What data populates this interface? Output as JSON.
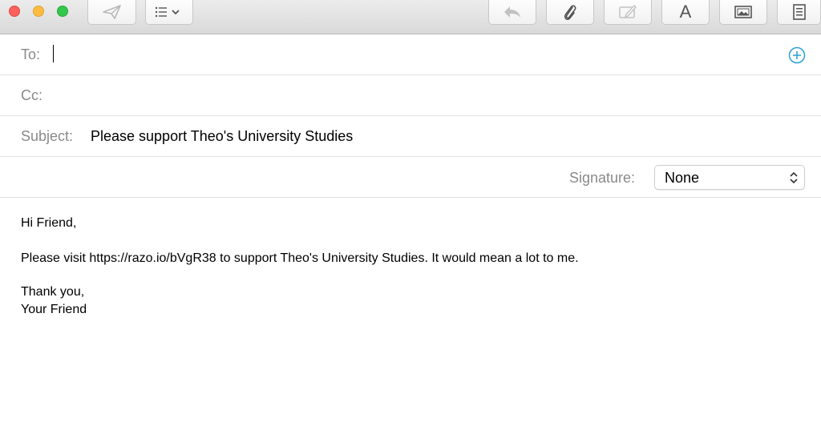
{
  "toolbar": {
    "buttons": [
      {
        "name": "send",
        "icon": "paper-plane-icon"
      },
      {
        "name": "format-list",
        "icon": "list-chevron-icon"
      },
      {
        "name": "reply",
        "icon": "reply-arrow-icon"
      },
      {
        "name": "attach",
        "icon": "paperclip-icon"
      },
      {
        "name": "markup",
        "icon": "markup-icon"
      },
      {
        "name": "fonts",
        "icon": "font-icon",
        "label": "A"
      },
      {
        "name": "photo-browser",
        "icon": "photo-icon"
      },
      {
        "name": "format-bar",
        "icon": "document-icon"
      }
    ]
  },
  "header": {
    "to_label": "To:",
    "to_value": "",
    "cc_label": "Cc:",
    "cc_value": "",
    "subject_label": "Subject:",
    "subject_value": "Please support Theo's University Studies",
    "signature_label": "Signature:",
    "signature_value": "None"
  },
  "body": {
    "greeting": "Hi Friend,",
    "message": "Please visit https://razo.io/bVgR38 to support Theo's University Studies. It would mean a lot to me.",
    "closing": "Thank you,",
    "sign_off": "Your Friend"
  },
  "colors": {
    "close": "#fc605b",
    "minimize": "#fdbc40",
    "zoom": "#34c84a",
    "accent": "#2a9fd6",
    "label_gray": "#8a8a8a"
  }
}
